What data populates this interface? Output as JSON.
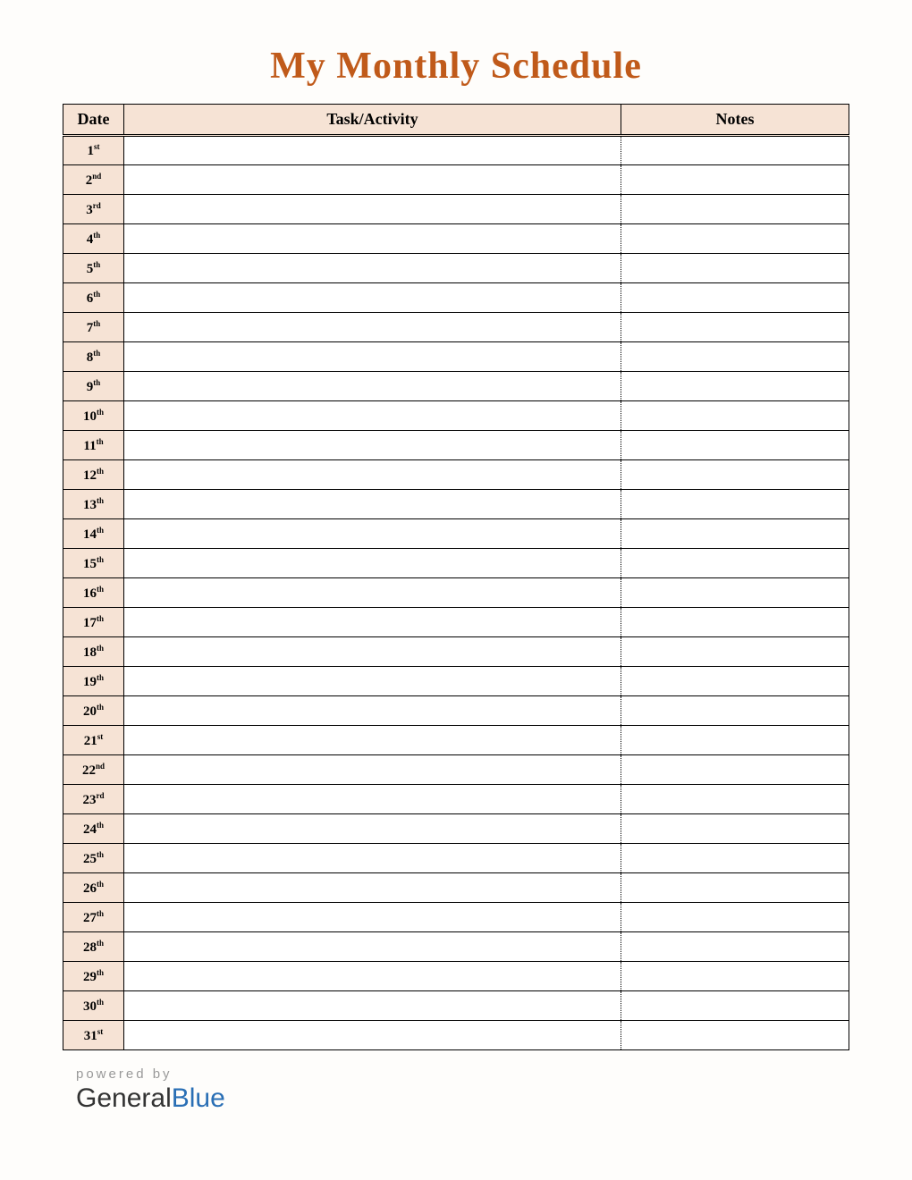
{
  "title": "My Monthly Schedule",
  "headers": {
    "date": "Date",
    "task": "Task/Activity",
    "notes": "Notes"
  },
  "rows": [
    {
      "day": "1",
      "suffix": "st",
      "task": "",
      "notes": ""
    },
    {
      "day": "2",
      "suffix": "nd",
      "task": "",
      "notes": ""
    },
    {
      "day": "3",
      "suffix": "rd",
      "task": "",
      "notes": ""
    },
    {
      "day": "4",
      "suffix": "th",
      "task": "",
      "notes": ""
    },
    {
      "day": "5",
      "suffix": "th",
      "task": "",
      "notes": ""
    },
    {
      "day": "6",
      "suffix": "th",
      "task": "",
      "notes": ""
    },
    {
      "day": "7",
      "suffix": "th",
      "task": "",
      "notes": ""
    },
    {
      "day": "8",
      "suffix": "th",
      "task": "",
      "notes": ""
    },
    {
      "day": "9",
      "suffix": "th",
      "task": "",
      "notes": ""
    },
    {
      "day": "10",
      "suffix": "th",
      "task": "",
      "notes": ""
    },
    {
      "day": "11",
      "suffix": "th",
      "task": "",
      "notes": ""
    },
    {
      "day": "12",
      "suffix": "th",
      "task": "",
      "notes": ""
    },
    {
      "day": "13",
      "suffix": "th",
      "task": "",
      "notes": ""
    },
    {
      "day": "14",
      "suffix": "th",
      "task": "",
      "notes": ""
    },
    {
      "day": "15",
      "suffix": "th",
      "task": "",
      "notes": ""
    },
    {
      "day": "16",
      "suffix": "th",
      "task": "",
      "notes": ""
    },
    {
      "day": "17",
      "suffix": "th",
      "task": "",
      "notes": ""
    },
    {
      "day": "18",
      "suffix": "th",
      "task": "",
      "notes": ""
    },
    {
      "day": "19",
      "suffix": "th",
      "task": "",
      "notes": ""
    },
    {
      "day": "20",
      "suffix": "th",
      "task": "",
      "notes": ""
    },
    {
      "day": "21",
      "suffix": "st",
      "task": "",
      "notes": ""
    },
    {
      "day": "22",
      "suffix": "nd",
      "task": "",
      "notes": ""
    },
    {
      "day": "23",
      "suffix": "rd",
      "task": "",
      "notes": ""
    },
    {
      "day": "24",
      "suffix": "th",
      "task": "",
      "notes": ""
    },
    {
      "day": "25",
      "suffix": "th",
      "task": "",
      "notes": ""
    },
    {
      "day": "26",
      "suffix": "th",
      "task": "",
      "notes": ""
    },
    {
      "day": "27",
      "suffix": "th",
      "task": "",
      "notes": ""
    },
    {
      "day": "28",
      "suffix": "th",
      "task": "",
      "notes": ""
    },
    {
      "day": "29",
      "suffix": "th",
      "task": "",
      "notes": ""
    },
    {
      "day": "30",
      "suffix": "th",
      "task": "",
      "notes": ""
    },
    {
      "day": "31",
      "suffix": "st",
      "task": "",
      "notes": ""
    }
  ],
  "footer": {
    "powered": "powered by",
    "brand1": "General",
    "brand2": "Blue"
  }
}
